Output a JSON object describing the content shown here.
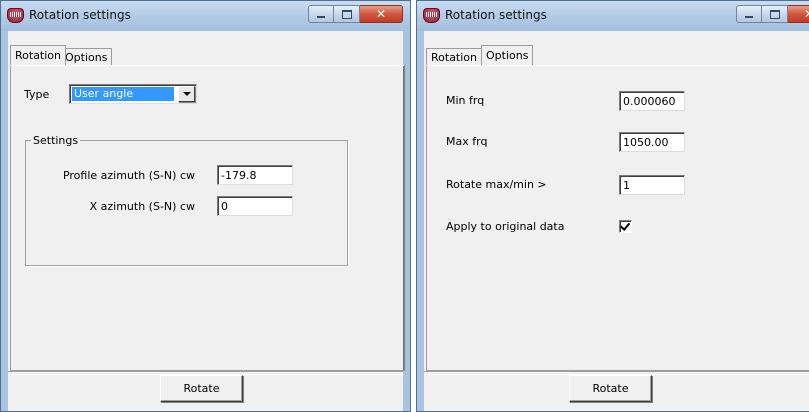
{
  "colors": {
    "window_frame": "#a8c4e2",
    "client_bg": "#f0f0f0",
    "selection": "#3399ff",
    "close_button": "#c03c24"
  },
  "left_window": {
    "title": "Rotation settings",
    "app_icon": "geophysics-app-icon",
    "caption_buttons": {
      "minimize": "minimize-icon",
      "maximize": "maximize-icon",
      "close": "✕"
    },
    "tabs": [
      {
        "label": "Rotation",
        "active": true
      },
      {
        "label": "Options",
        "active": false
      }
    ],
    "type_label": "Type",
    "type_value": "User angle",
    "settings_group": {
      "legend": "Settings",
      "profile_azimuth_label": "Profile  azimuth (S-N) cw",
      "profile_azimuth_value": "-179.8",
      "x_azimuth_label": "X azimuth (S-N) cw",
      "x_azimuth_value": "0"
    },
    "rotate_button": "Rotate"
  },
  "right_window": {
    "title": "Rotation settings",
    "app_icon": "geophysics-app-icon",
    "caption_buttons": {
      "minimize": "minimize-icon",
      "maximize": "maximize-icon",
      "close": "✕"
    },
    "tabs": [
      {
        "label": "Rotation",
        "active": false
      },
      {
        "label": "Options",
        "active": true
      }
    ],
    "min_frq_label": "Min frq",
    "min_frq_value": "0.000060",
    "max_frq_label": "Max frq",
    "max_frq_value": "1050.00",
    "rotate_maxmin_label": "Rotate max/min >",
    "rotate_maxmin_value": "1",
    "apply_label": "Apply to original data",
    "apply_checked": true,
    "rotate_button": "Rotate"
  }
}
